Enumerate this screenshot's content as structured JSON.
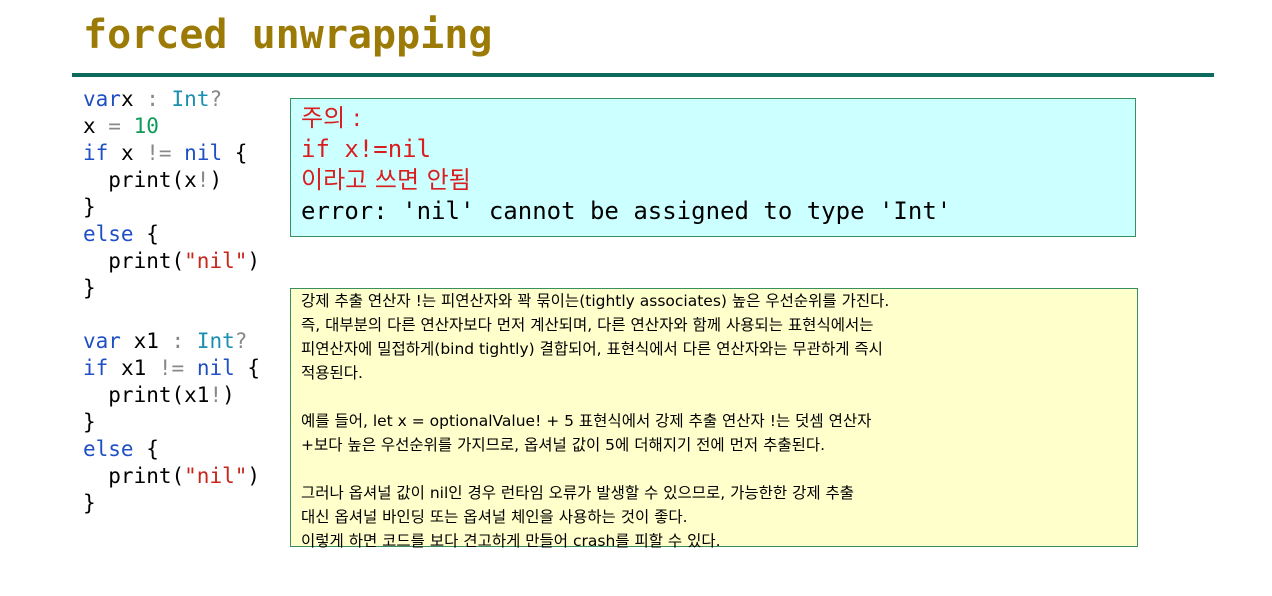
{
  "slide": {
    "title": "forced unwrapping"
  },
  "code_block_1": {
    "lines": [
      {
        "t": [
          [
            "kw",
            "var"
          ],
          [
            "",
            "x "
          ],
          [
            "op",
            ":"
          ],
          [
            "ty",
            " Int"
          ],
          [
            "op",
            "?"
          ]
        ]
      },
      {
        "t": [
          [
            "",
            "x "
          ],
          [
            "op",
            "="
          ],
          [
            "num",
            " 10"
          ]
        ]
      },
      {
        "t": [
          [
            "kw",
            "if"
          ],
          [
            "",
            " x "
          ],
          [
            "op",
            "!="
          ],
          [
            "kw",
            " nil"
          ],
          [
            "",
            " {"
          ]
        ]
      },
      {
        "t": [
          [
            "",
            "  print(x"
          ],
          [
            "op",
            "!"
          ],
          [
            "",
            ")"
          ]
        ]
      },
      {
        "t": [
          [
            "",
            "}"
          ]
        ]
      },
      {
        "t": [
          [
            "kw",
            "else"
          ],
          [
            "",
            " {"
          ]
        ]
      },
      {
        "t": [
          [
            "",
            "  print("
          ],
          [
            "str",
            "\"nil\""
          ],
          [
            "",
            ")"
          ]
        ]
      },
      {
        "t": [
          [
            "",
            "}"
          ]
        ]
      }
    ]
  },
  "code_block_2": {
    "lines": [
      {
        "t": [
          [
            "kw",
            "var"
          ],
          [
            "",
            " x1 "
          ],
          [
            "op",
            ":"
          ],
          [
            "ty",
            " Int"
          ],
          [
            "op",
            "?"
          ]
        ]
      },
      {
        "t": [
          [
            "kw",
            "if"
          ],
          [
            "",
            " x1 "
          ],
          [
            "op",
            "!="
          ],
          [
            "kw",
            " nil"
          ],
          [
            "",
            " {"
          ]
        ]
      },
      {
        "t": [
          [
            "",
            "  print(x1"
          ],
          [
            "op",
            "!"
          ],
          [
            "",
            ")"
          ]
        ]
      },
      {
        "t": [
          [
            "",
            "}"
          ]
        ]
      },
      {
        "t": [
          [
            "kw",
            "else"
          ],
          [
            "",
            " {"
          ]
        ]
      },
      {
        "t": [
          [
            "",
            "  print("
          ],
          [
            "str",
            "\"nil\""
          ],
          [
            "",
            ")"
          ]
        ]
      },
      {
        "t": [
          [
            "",
            "}"
          ]
        ]
      }
    ]
  },
  "warning_box": {
    "line1": "주의 :",
    "line2": "if x!=nil",
    "line3": "이라고 쓰면 안됨",
    "line4": "error: 'nil' cannot be assigned to type 'Int'"
  },
  "explanation_box": {
    "para1": [
      "강제 추출 연산자 !는 피연산자와 꽉 묶이는(tightly associates) 높은 우선순위를 가진다.",
      "즉, 대부분의 다른 연산자보다 먼저 계산되며, 다른 연산자와 함께 사용되는 표현식에서는",
      "피연산자에 밀접하게(bind tightly) 결합되어, 표현식에서 다른 연산자와는 무관하게 즉시",
      "적용된다."
    ],
    "para2": [
      "예를 들어, let x = optionalValue! + 5 표현식에서 강제 추출 연산자 !는 덧셈 연산자",
      "+보다 높은 우선순위를 가지므로, 옵셔널 값이 5에 더해지기 전에 먼저 추출된다."
    ],
    "para3": [
      "그러나 옵셔널 값이 nil인 경우 런타임 오류가 발생할 수 있으므로, 가능한한 강제 추출",
      "대신 옵셔널 바인딩 또는 옵셔널 체인을 사용하는 것이 좋다.",
      "이렇게 하면 코드를 보다 견고하게 만들어 crash를 피할 수 있다."
    ]
  },
  "colors": {
    "title": "#9c7a06",
    "rule": "#0d6b5e",
    "keyword": "#1f4fc4",
    "type": "#1a8fb0",
    "number": "#0f9a5a",
    "string": "#c8251b",
    "warning_bg": "#ccffff",
    "warning_text": "#d81e1e",
    "explanation_bg": "#ffffcc"
  }
}
